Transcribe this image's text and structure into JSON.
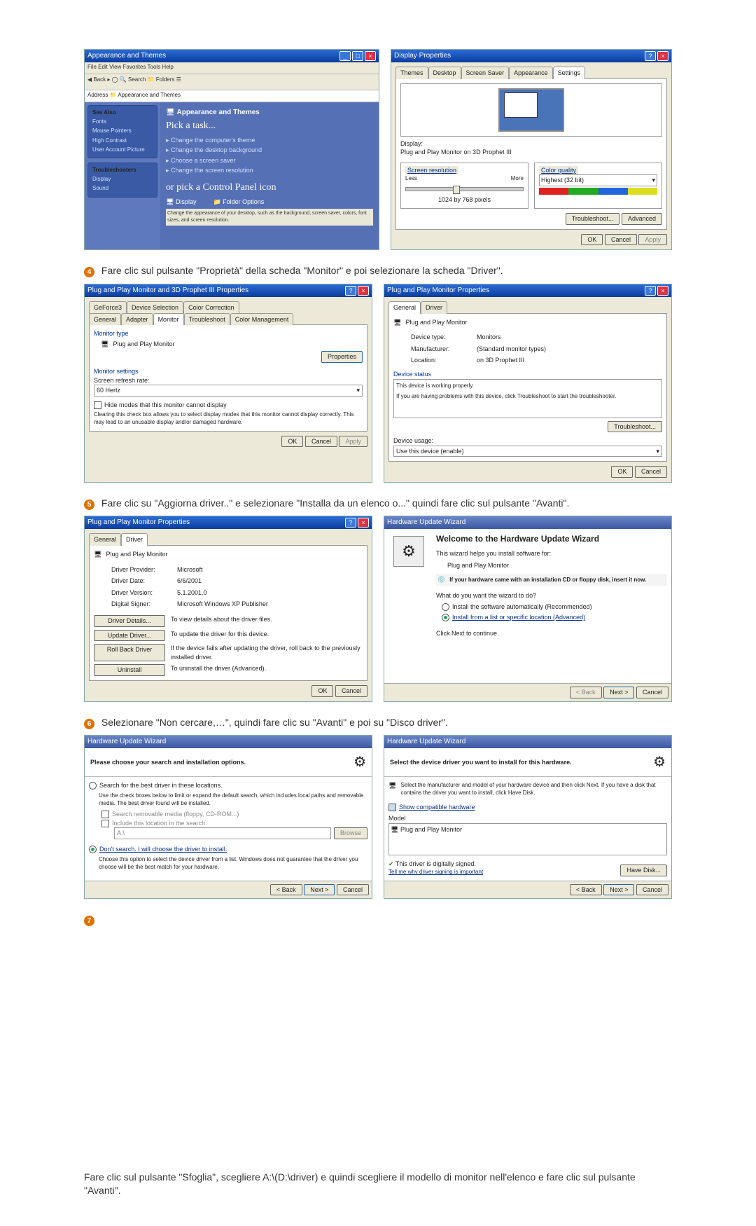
{
  "step4": {
    "text": "Fare clic sul pulsante \"Proprietà\" della scheda \"Monitor\" e poi selezionare la scheda \"Driver\".",
    "num": "4"
  },
  "step5": {
    "text": "Fare clic su \"Aggiorna driver..\" e selezionare \"Installa da un elenco o...\" quindi fare clic sul pulsante \"Avanti\".",
    "num": "5"
  },
  "step6": {
    "text": "Selezionare \"Non cercare,…\", quindi fare clic su \"Avanti\" e poi su \"Disco driver\".",
    "num": "6"
  },
  "step7": {
    "num": "7",
    "text": "Fare clic sul pulsante \"Sfoglia\", scegliere A:\\(D:\\driver) e quindi scegliere il modello di monitor nell'elenco e fare clic sul pulsante \"Avanti\"."
  },
  "controlpanel": {
    "title": "Appearance and Themes",
    "picktask": "Pick a task...",
    "task1": "Change the computer's theme",
    "task2": "Change the desktop background",
    "task3": "Choose a screen saver",
    "task4": "Change the screen resolution",
    "orpick": "or pick a Control Panel icon",
    "icon1": "Display",
    "icon2": "Folder Options",
    "seealso": "See Also",
    "trouble": "Troubleshooters"
  },
  "displayprops": {
    "title": "Display Properties",
    "tabs": {
      "themes": "Themes",
      "desktop": "Desktop",
      "ss": "Screen Saver",
      "app": "Appearance",
      "settings": "Settings"
    },
    "display_label": "Display:",
    "display_value": "Plug and Play Monitor on 3D Prophet III",
    "res_label": "Screen resolution",
    "less": "Less",
    "more": "More",
    "res_value": "1024 by 768 pixels",
    "cq_label": "Color quality",
    "cq_value": "Highest (32 bit)",
    "troubleshoot": "Troubleshoot...",
    "advanced": "Advanced",
    "ok": "OK",
    "cancel": "Cancel",
    "apply": "Apply"
  },
  "advprops": {
    "title": "Plug and Play Monitor and 3D Prophet III Properties",
    "tabs_top": {
      "gf": "GeForce3",
      "ds": "Device Selection",
      "cc": "Color Correction"
    },
    "tabs_bot": {
      "gen": "General",
      "ad": "Adapter",
      "mon": "Monitor",
      "tb": "Troubleshoot",
      "cm": "Color Management"
    },
    "monitor_type": "Monitor type",
    "monitor_value": "Plug and Play Monitor",
    "properties": "Properties",
    "monitor_settings": "Monitor settings",
    "refresh": "Screen refresh rate:",
    "refresh_value": "60 Hertz",
    "hide_modes": "Hide modes that this monitor cannot display",
    "hide_desc": "Clearing this check box allows you to select display modes that this monitor cannot display correctly. This may lead to an unusable display and/or damaged hardware.",
    "ok": "OK",
    "cancel": "Cancel",
    "apply": "Apply"
  },
  "pnpprops": {
    "title": "Plug and Play Monitor Properties",
    "tabs": {
      "gen": "General",
      "drv": "Driver"
    },
    "name": "Plug and Play Monitor",
    "devtype_l": "Device type:",
    "devtype_v": "Monitors",
    "manu_l": "Manufacturer:",
    "manu_v": "(Standard monitor types)",
    "loc_l": "Location:",
    "loc_v": "on 3D Prophet III",
    "status_l": "Device status",
    "status_v": "This device is working properly.",
    "status_hint": "If you are having problems with this device, click Troubleshoot to start the troubleshooter.",
    "troubleshoot": "Troubleshoot...",
    "usage_l": "Device usage:",
    "usage_v": "Use this device (enable)",
    "ok": "OK",
    "cancel": "Cancel"
  },
  "drvtab": {
    "title": "Plug and Play Monitor Properties",
    "tabs": {
      "gen": "General",
      "drv": "Driver"
    },
    "name": "Plug and Play Monitor",
    "provider_l": "Driver Provider:",
    "provider_v": "Microsoft",
    "date_l": "Driver Date:",
    "date_v": "6/6/2001",
    "ver_l": "Driver Version:",
    "ver_v": "5.1.2001.0",
    "signer_l": "Digital Signer:",
    "signer_v": "Microsoft Windows XP Publisher",
    "details_btn": "Driver Details...",
    "details_txt": "To view details about the driver files.",
    "update_btn": "Update Driver...",
    "update_txt": "To update the driver for this device.",
    "rollback_btn": "Roll Back Driver",
    "rollback_txt": "If the device fails after updating the driver, roll back to the previously installed driver.",
    "uninstall_btn": "Uninstall",
    "uninstall_txt": "To uninstall the driver (Advanced).",
    "ok": "OK",
    "cancel": "Cancel"
  },
  "wiz1": {
    "title": "Hardware Update Wizard",
    "welcome": "Welcome to the Hardware Update Wizard",
    "helps": "This wizard helps you install software for:",
    "dev": "Plug and Play Monitor",
    "cd_hint": "If your hardware came with an installation CD or floppy disk, insert it now.",
    "what": "What do you want the wizard to do?",
    "opt_auto": "Install the software automatically (Recommended)",
    "opt_list": "Install from a list or specific location (Advanced)",
    "cont": "Click Next to continue.",
    "back": "< Back",
    "next": "Next >",
    "cancel": "Cancel"
  },
  "wiz2": {
    "title": "Hardware Update Wizard",
    "heading": "Please choose your search and installation options.",
    "search_opt": "Search for the best driver in these locations.",
    "search_desc": "Use the check boxes below to limit or expand the default search, which includes local paths and removable media. The best driver found will be installed.",
    "chk_remov": "Search removable media (floppy, CD-ROM...)",
    "chk_loc": "Include this location in the search:",
    "path": "A:\\",
    "browse": "Browse",
    "dont_opt": "Don't search. I will choose the driver to install.",
    "dont_desc": "Choose this option to select the device driver from a list. Windows does not guarantee that the driver you choose will be the best match for your hardware.",
    "back": "< Back",
    "next": "Next >",
    "cancel": "Cancel"
  },
  "wiz3": {
    "title": "Hardware Update Wizard",
    "heading": "Select the device driver you want to install for this hardware.",
    "desc": "Select the manufacturer and model of your hardware device and then click Next. If you have a disk that contains the driver you want to install, click Have Disk.",
    "show_compat": "Show compatible hardware",
    "model_l": "Model",
    "model_v": "Plug and Play Monitor",
    "signed": "This driver is digitally signed.",
    "why": "Tell me why driver signing is important",
    "havedisk": "Have Disk...",
    "back": "< Back",
    "next": "Next >",
    "cancel": "Cancel"
  }
}
